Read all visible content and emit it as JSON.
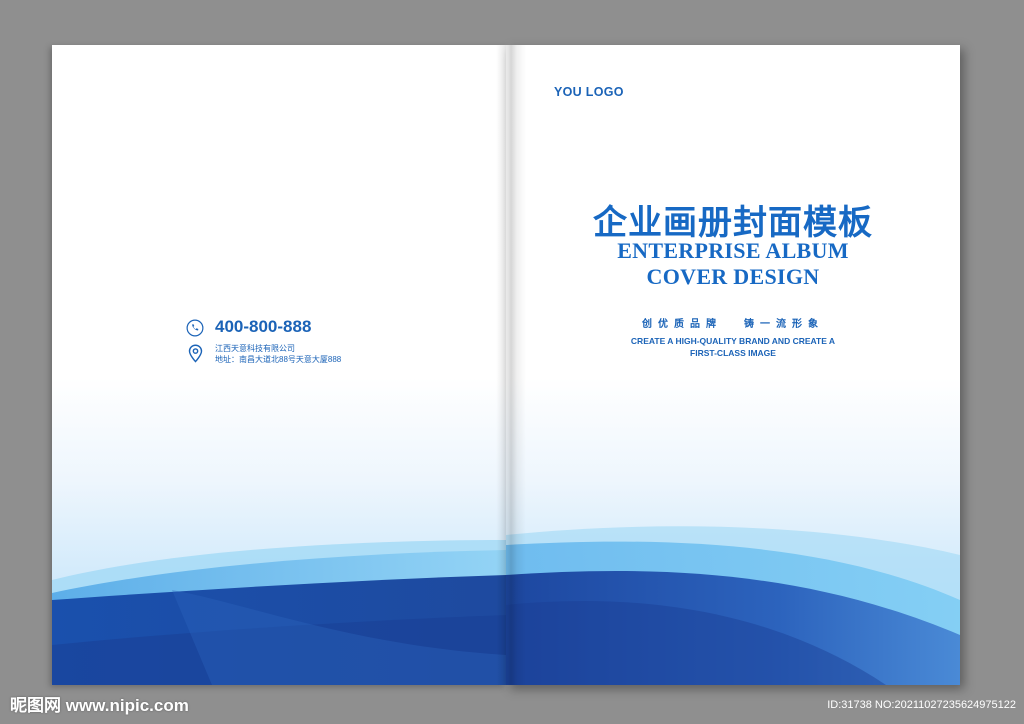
{
  "colors": {
    "background": "#8f8f8f",
    "primary_blue": "#1b63b7",
    "title_blue": "#1769c4",
    "wave_light": "#7ec6f1",
    "wave_dark": "#1d4aa1"
  },
  "back_cover": {
    "phone_icon": "phone-icon",
    "phone": "400-800-888",
    "location_icon": "location-pin-icon",
    "company": "江西天意科技有限公司",
    "address": "地址：南昌大道北88号天意大厦888"
  },
  "front_cover": {
    "logo": "YOU LOGO",
    "title_cn": "企业画册封面模板",
    "title_en_line1": "ENTERPRISE ALBUM",
    "title_en_line2": "COVER DESIGN",
    "slogan_cn_part1": "创优质品牌",
    "slogan_cn_part2": "铸一流形象",
    "slogan_en_line1": "CREATE A HIGH-QUALITY BRAND AND CREATE A",
    "slogan_en_line2": "FIRST-CLASS IMAGE"
  },
  "watermark": {
    "site": "昵图网 www.nipic.com",
    "id_text": "ID:31738 NO:20211027235624975122"
  }
}
